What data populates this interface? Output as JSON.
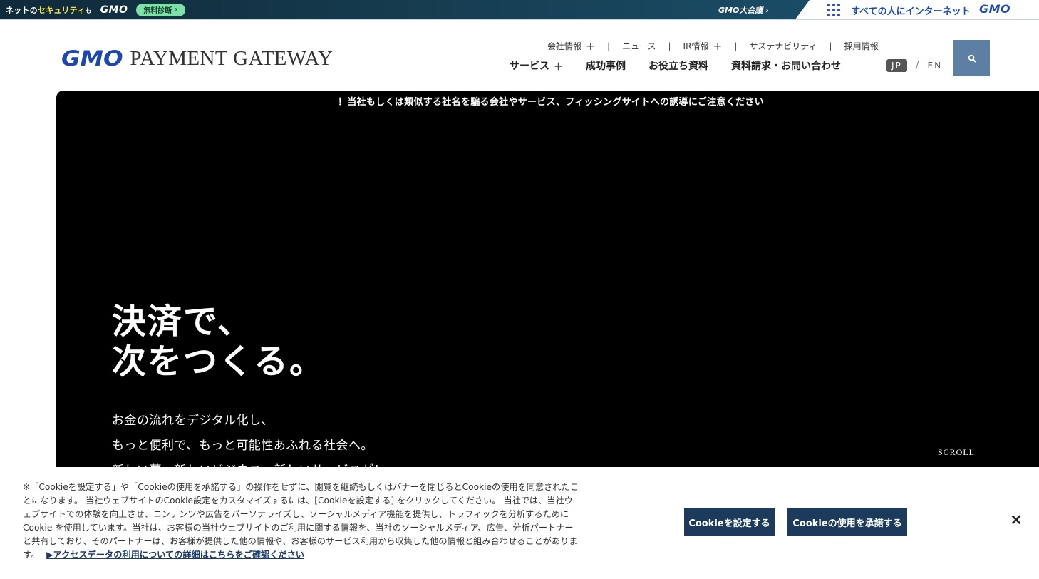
{
  "topbar": {
    "security_pre": "ネットの",
    "security_hl": "セキュリティ",
    "security_post": "も",
    "gmo_left": "GMO",
    "free_diagnosis": "無料診断",
    "taikai": "GMO大会議",
    "all_people": "すべての人にインターネット",
    "gmo_right": "GMO"
  },
  "header": {
    "logo_gmo": "GMO",
    "logo_text": "PAYMENT GATEWAY",
    "subnav": [
      "会社情報",
      "ニュース",
      "IR情報",
      "サステナビリティ",
      "採用情報"
    ],
    "mainnav": [
      "サービス",
      "成功事例",
      "お役立ち資料",
      "資料請求・お問い合わせ"
    ],
    "lang_jp": "JP",
    "lang_slash": "/",
    "lang_en": "EN"
  },
  "hero": {
    "notice": "！当社もしくは類似する社名を騙る会社やサービス、フィッシングサイトへの誘導にご注意ください",
    "catch_line1": "決済で、",
    "catch_line2": "次をつくる。",
    "lead_line1": "お金の流れをデジタル化し、",
    "lead_line2": "もっと便利で、もっと可能性あふれる社会へ。",
    "lead_line3": "新しい夢、新しいビジネス、新しいサービスが！",
    "scroll": "SCROLL"
  },
  "cookie": {
    "text": "※「Cookieを設定する」や「Cookieの使用を承諾する」の操作をせずに、閲覧を継続もしくはバナーを閉じるとCookieの使用を同意されたことになります。 当社ウェブサイトのCookie設定をカスタマイズするには、[Cookieを設定する] をクリックしてください。 当社では、当社ウェブサイトでの体験を向上させ、コンテンツや広告をパーソナライズし、ソーシャルメディア機能を提供し、トラフィックを分析するために Cookie を使用しています。当社は、お客様の当社ウェブサイトのご利用に関する情報を、当社のソーシャルメディア、広告、分析パートナーと共有しており、そのパートナーは、お客様が提供した他の情報や、お客様のサービス利用から収集した他の情報と組み合わせることがあります。",
    "link": "▶アクセスデータの利用についての詳細はこちらをご確認ください",
    "settings_button": "Cookieを設定する",
    "accept_button": "Cookieの使用を承諾する",
    "close": "✕"
  }
}
